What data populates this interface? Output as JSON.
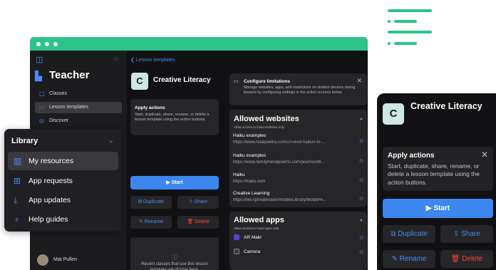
{
  "window": {
    "sidebar": {
      "title": "Teacher",
      "items": [
        {
          "label": "Classes",
          "icon": "classes-icon",
          "active": false
        },
        {
          "label": "Lesson templates",
          "icon": "templates-icon",
          "active": true
        },
        {
          "label": "Discover",
          "icon": "compass-icon",
          "active": false
        }
      ],
      "user": "Mat Pullen"
    },
    "back_label": "Lesson templates",
    "lesson": {
      "initial": "C",
      "title": "Creative Literacy"
    },
    "apply_card": {
      "title": "Apply actions",
      "text": "Start, duplicate, share, rename, or delete a lesson template using the action buttons."
    },
    "buttons": {
      "start": "Start",
      "duplicate": "Duplicate",
      "share": "Share",
      "rename": "Rename",
      "delete": "Delete"
    },
    "recent_text": "Recent classes that use this lesson template will display here.",
    "limits_card": {
      "title": "Configure limitations",
      "text": "Manage websites, apps, and restrictions on student devices during lessons by configuring settings in the action screens below."
    },
    "websites": {
      "title": "Allowed websites",
      "subtitle": "Allow access to listed websites only",
      "rows": [
        {
          "name": "Haiku examples",
          "url": "https://www.readpoetry.com/10-vivid-haikus-to-..."
        },
        {
          "name": "Haiku examples",
          "url": "https://www.familyfriendpoems.com/poems/oth..."
        },
        {
          "name": "Haiku",
          "url": "https://haiku.com"
        },
        {
          "name": "Creative Learning",
          "url": "https://file://privateruser/mobile/Library/Mobile%..."
        }
      ]
    },
    "apps": {
      "title": "Allowed apps",
      "subtitle": "Allow access to listed apps only",
      "rows": [
        {
          "name": "AR Makr"
        },
        {
          "name": "Camera"
        }
      ]
    }
  },
  "library": {
    "title": "Library",
    "items": [
      {
        "label": "My resources",
        "icon": "books-icon",
        "active": true
      },
      {
        "label": "App requests",
        "icon": "plus-square-icon",
        "active": false
      },
      {
        "label": "App updates",
        "icon": "download-icon",
        "active": false
      },
      {
        "label": "Help guides",
        "icon": "lightbulb-icon",
        "active": false
      }
    ]
  },
  "mini": {
    "initial": "C",
    "title": "Creative Literacy",
    "apply_title": "Apply actions",
    "apply_text": "Start, duplicate, share, rename, or delete a lesson template using the action buttons.",
    "buttons": {
      "start": "Start",
      "duplicate": "Duplicate",
      "share": "Share",
      "rename": "Rename",
      "delete": "Delete"
    }
  },
  "colors": {
    "accent_green": "#2bc48a",
    "accent_blue": "#3c87f0",
    "danger": "#ff453a",
    "bg_dark": "#151517"
  }
}
